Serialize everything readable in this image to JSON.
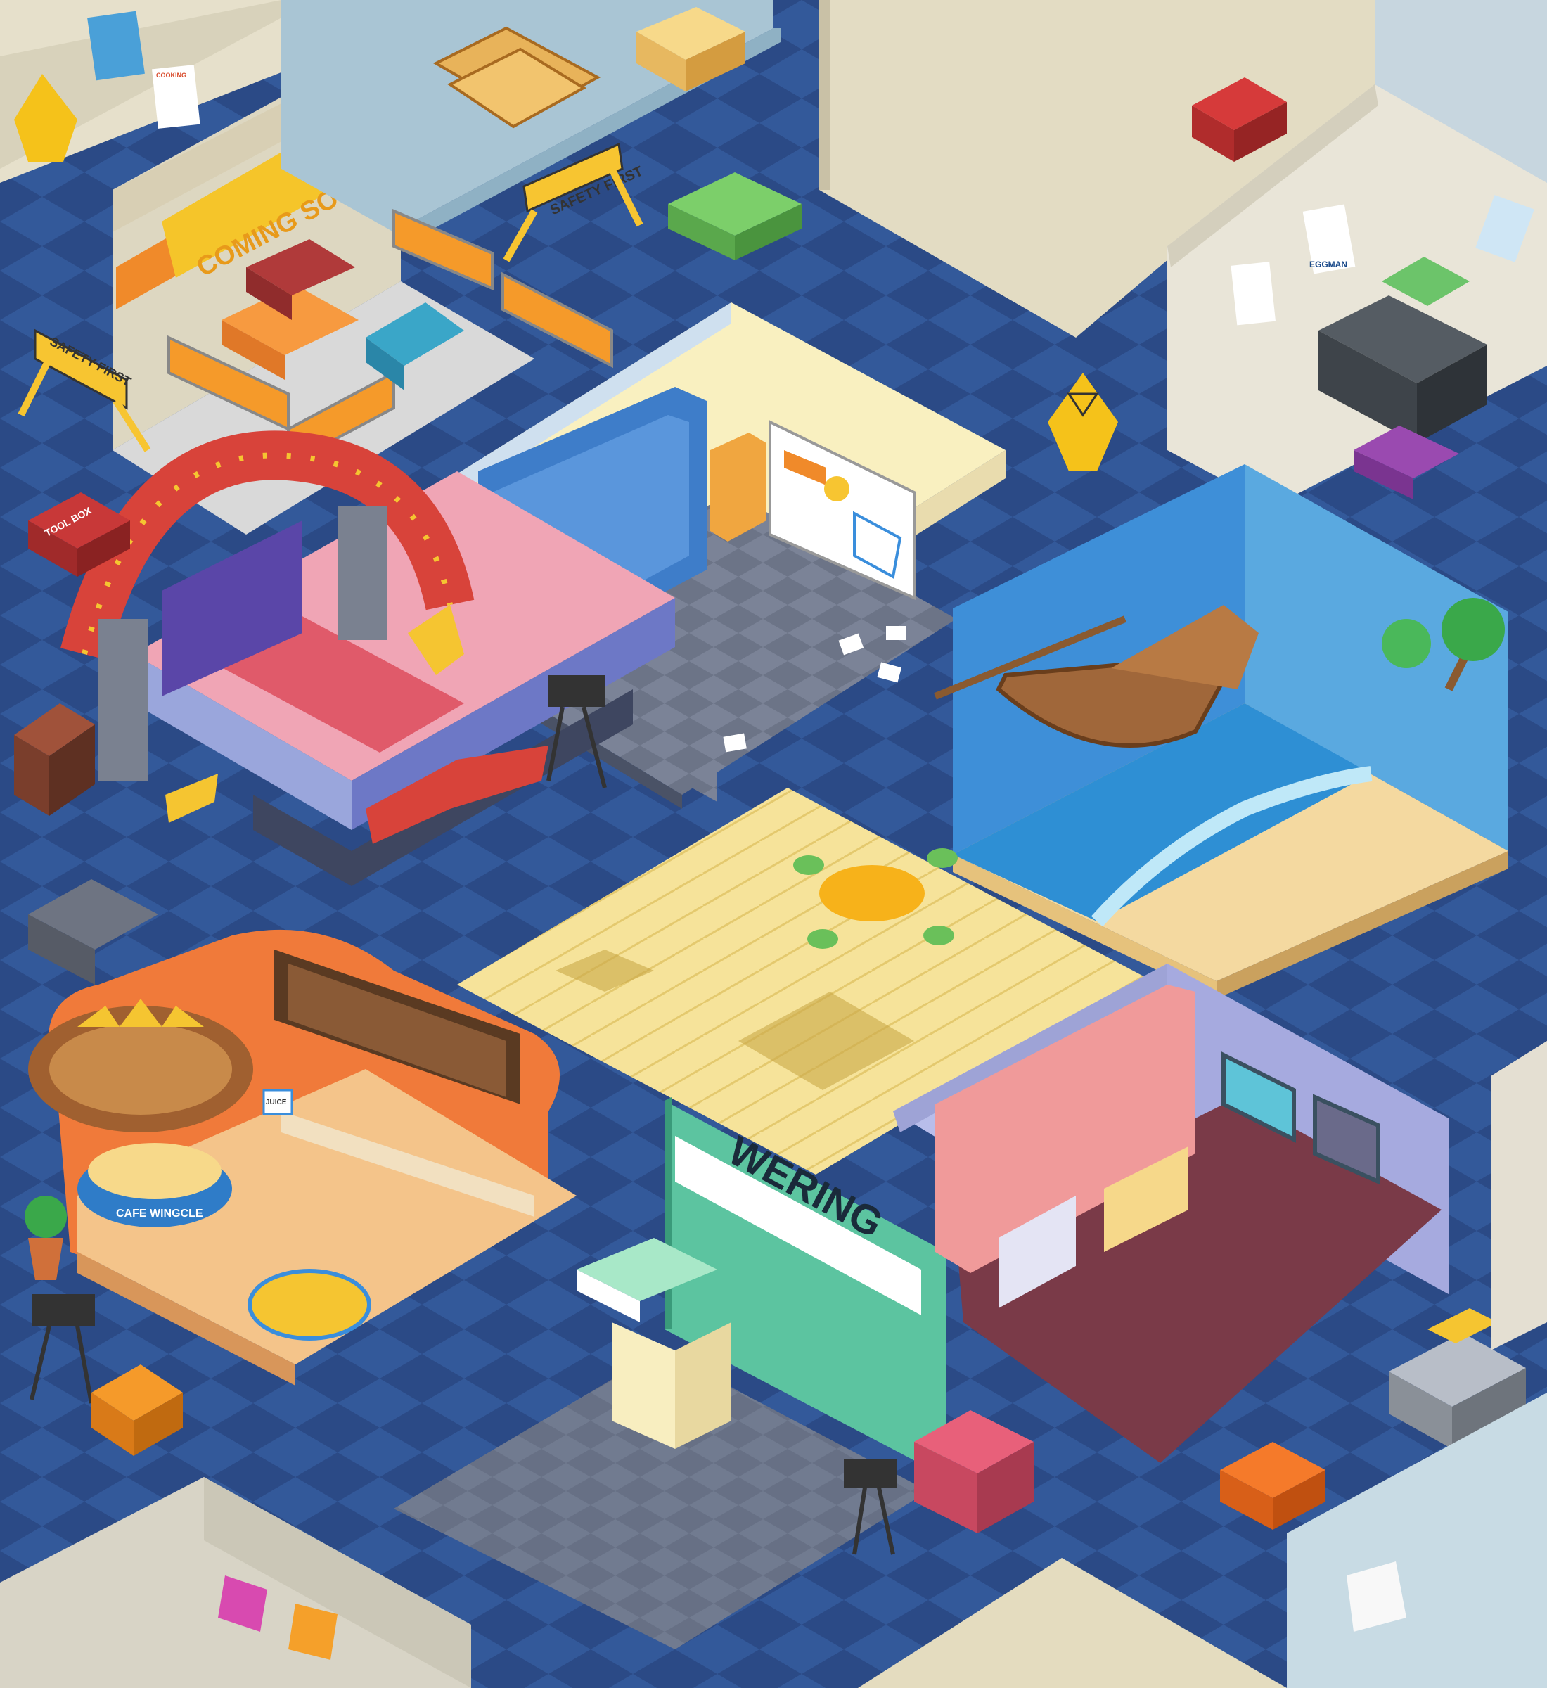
{
  "scene": {
    "signs": {
      "coming_soon": "COMING SOON",
      "safety_first_1": "SAFETY FIRST",
      "safety_first_2": "SAFETY FIRST",
      "tool_box": "TOOL BOX",
      "weiring": "WERING",
      "cafe_cup": "CAFE WINGCLE",
      "poster_eggman": "EGGMAN",
      "poster_cooking": "COOKING",
      "poster_cafe_menu": "JUICE"
    },
    "colors": {
      "floor_dark": "#2b4a86",
      "floor_tile": "#33599a",
      "wall_beige": "#dcd6bf",
      "stage_red": "#d8433a",
      "cafe_orange": "#f07a3a",
      "sea_blue": "#2e8fd4",
      "sand": "#f4d9a0",
      "yellow_floor": "#f6e39a",
      "pink_machine": "#f2a0a0",
      "wering_green": "#5cc4a0"
    }
  }
}
